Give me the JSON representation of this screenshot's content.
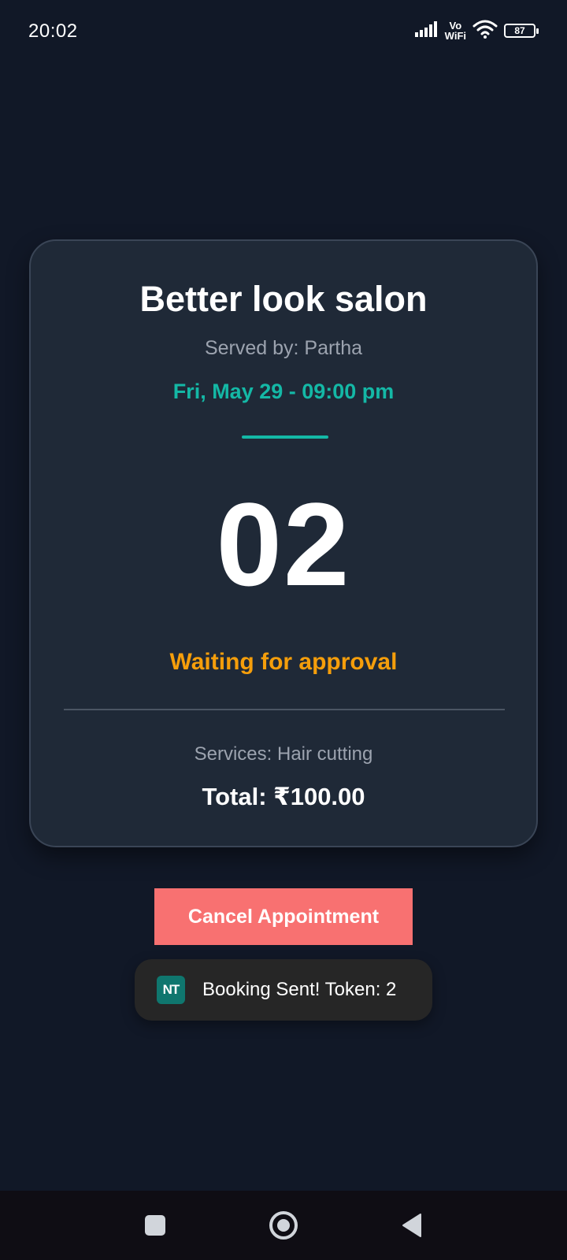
{
  "status_bar": {
    "time": "20:02",
    "network_label_top": "Vo",
    "network_label_bottom": "WiFi",
    "battery_level": "87",
    "icons": [
      "signal-bars-icon",
      "vowifi-icon",
      "wifi-icon",
      "battery-icon"
    ]
  },
  "appointment": {
    "salon_name": "Better look salon",
    "served_by": "Served by: Partha",
    "datetime": "Fri, May 29 - 09:00 pm",
    "token_number": "02",
    "status": "Waiting for approval",
    "services": "Services: Hair cutting",
    "total": "Total: ₹100.00"
  },
  "actions": {
    "cancel_label": "Cancel Appointment"
  },
  "toast": {
    "app_icon_text": "NT",
    "message": "Booking Sent! Token: 2"
  },
  "navigation": {
    "buttons": [
      "recents-icon",
      "home-icon",
      "back-icon"
    ]
  },
  "colors": {
    "background": "#111827",
    "card": "#1f2937",
    "accent_teal": "#14b8a6",
    "status_orange": "#f59e0b",
    "cancel_red": "#f87171",
    "muted_text": "#9ca3af"
  }
}
